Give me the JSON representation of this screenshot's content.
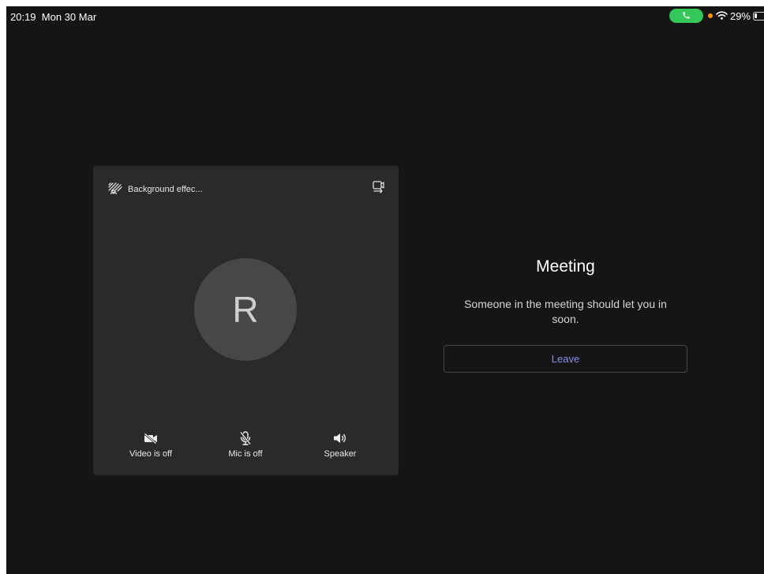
{
  "status_bar": {
    "time": "20:19",
    "date": "Mon 30 Mar",
    "battery_percent": "29%",
    "battery_level": 0.29,
    "call_indicator_color": "#34c759",
    "privacy_dot_color": "#ff9500"
  },
  "preview": {
    "background_effects_label": "Background effec...",
    "avatar_initial": "R",
    "controls": {
      "video_label": "Video is off",
      "mic_label": "Mic is off",
      "speaker_label": "Speaker"
    },
    "icons": [
      "background-effects-icon",
      "switch-camera-icon",
      "video-off-icon",
      "mic-off-icon",
      "speaker-icon"
    ]
  },
  "meeting": {
    "title": "Meeting",
    "message": "Someone in the meeting should let you in soon.",
    "leave_label": "Leave",
    "accent_color": "#8c8ff0"
  }
}
